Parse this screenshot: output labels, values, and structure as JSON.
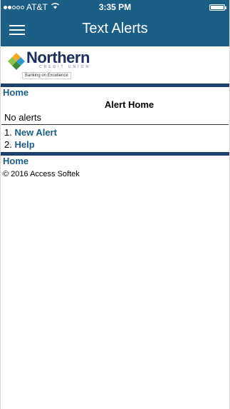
{
  "status_bar": {
    "carrier": "AT&T",
    "time": "3:35 PM",
    "signal_strength_dots": 2,
    "signal_total_dots": 5,
    "battery_level": 1.0
  },
  "navbar": {
    "title": "Text Alerts",
    "menu_icon": "hamburger-icon"
  },
  "logo": {
    "name": "Northern",
    "subtitle": "CREDIT UNION",
    "tagline": "Banking on Excellence"
  },
  "breadcrumb_top": "Home",
  "page": {
    "heading": "Alert Home",
    "empty_message": "No alerts",
    "menu": [
      {
        "number": "1.",
        "label": "New Alert"
      },
      {
        "number": "2.",
        "label": "Help"
      }
    ]
  },
  "breadcrumb_bottom": "Home",
  "footer": {
    "copyright": "© 2016 Access Softek"
  },
  "colors": {
    "header_bg": "#1c5f86",
    "link": "#1c5f86",
    "rule": "#1c3f6b"
  }
}
